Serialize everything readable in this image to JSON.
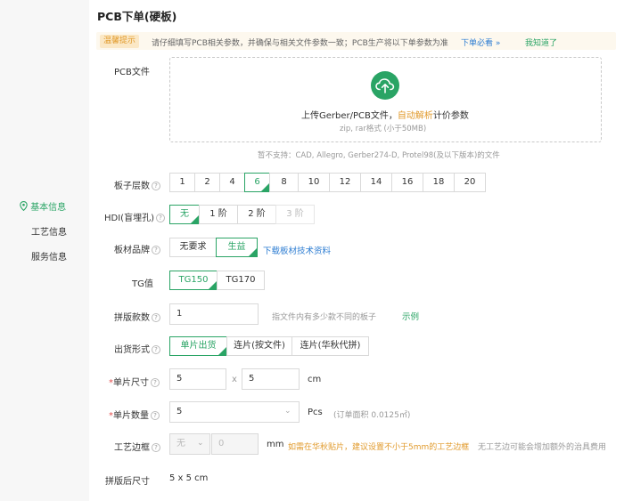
{
  "header": {
    "title": "PCB下单(硬板)"
  },
  "tip": {
    "tag": "温馨提示",
    "text": "请仔细填写PCB相关参数，并确保与相关文件参数一致；PCB生产将以下单参数为准",
    "link": "下单必看 »",
    "dismiss": "我知道了"
  },
  "sidebar": {
    "items": [
      {
        "label": "基本信息",
        "active": true,
        "icon": "location-pin-icon"
      },
      {
        "label": "工艺信息",
        "active": false
      },
      {
        "label": "服务信息",
        "active": false
      }
    ]
  },
  "upload": {
    "label": "PCB文件",
    "title_prefix": "上传Gerber/PCB文件，",
    "title_accent": "自动解析",
    "title_suffix": "计价参数",
    "sub": "zip, rar格式 (小于50MB)",
    "unsupported": "暂不支持：CAD, Allegro, Gerber274-D, Protel98(及以下版本)的文件",
    "icon": "cloud-upload-icon"
  },
  "layers": {
    "label": "板子层数",
    "options": [
      "1",
      "2",
      "4",
      "6",
      "8",
      "10",
      "12",
      "14",
      "16",
      "18",
      "20"
    ],
    "selected": "6"
  },
  "hdi": {
    "label": "HDI(盲埋孔)",
    "options": [
      "无",
      "1 阶",
      "2 阶",
      "3 阶"
    ],
    "selected": "无",
    "disabled": [
      "3 阶"
    ]
  },
  "brand": {
    "label": "板材品牌",
    "options": [
      "无要求",
      "生益"
    ],
    "selected": "生益",
    "link": "下载板材技术资料"
  },
  "tg": {
    "label": "TG值",
    "options": [
      "TG150",
      "TG170"
    ],
    "selected": "TG150"
  },
  "panel_count": {
    "label": "拼版款数",
    "value": "1",
    "note": "指文件内有多少款不同的板子",
    "example": "示例"
  },
  "shipping": {
    "label": "出货形式",
    "options": [
      "单片出货",
      "连片(按文件)",
      "连片(华秋代拼)"
    ],
    "selected": "单片出货"
  },
  "unit_size": {
    "label": "单片尺寸",
    "width": "5",
    "height": "5",
    "separator": "x",
    "unit": "cm"
  },
  "quantity": {
    "label": "单片数量",
    "value": "5",
    "unit": "Pcs",
    "note": "(订单面积 0.0125㎡)"
  },
  "process_edge": {
    "label": "工艺边框",
    "select": "无",
    "value": "0",
    "unit": "mm",
    "warn": "如需在华秋贴片，建议设置不小于5mm的工艺边框",
    "note": "无工艺边可能会增加额外的治具费用"
  },
  "panel_size": {
    "label": "拼版后尺寸",
    "value": "5 x 5 cm"
  },
  "colors": {
    "accent_green": "#2aa465",
    "link_blue": "#2d7dd2",
    "warn_orange": "#e19a2b"
  }
}
